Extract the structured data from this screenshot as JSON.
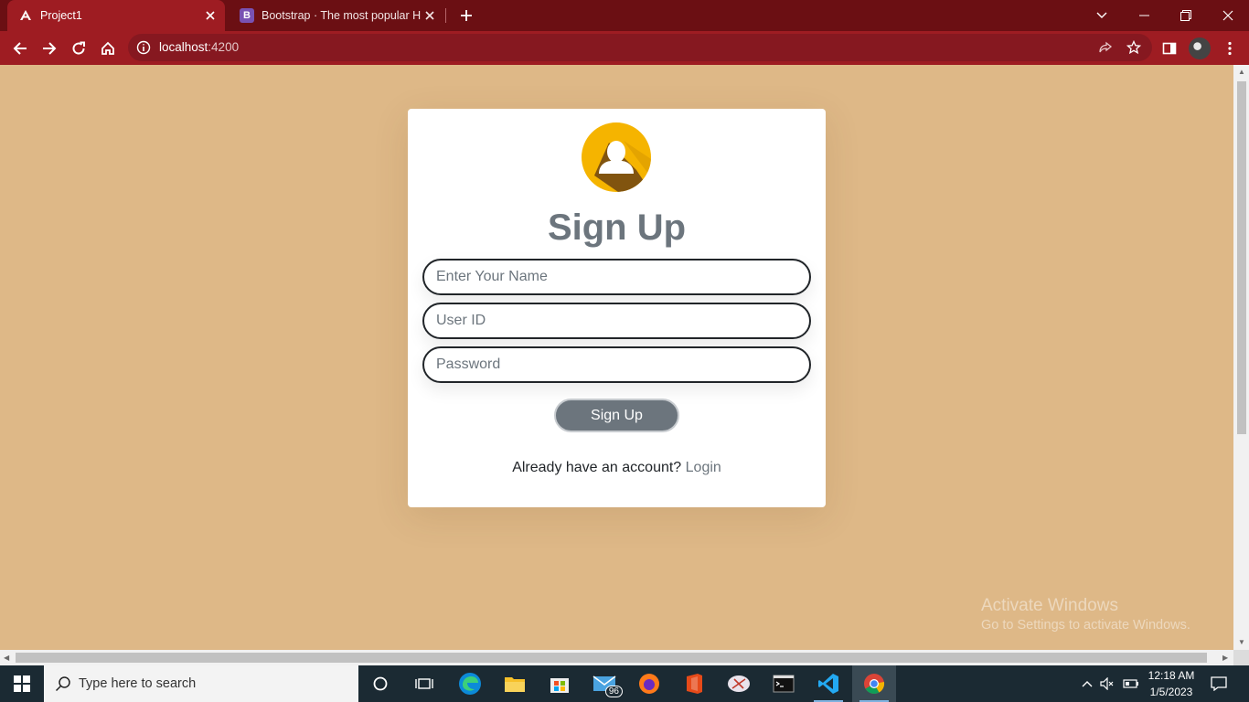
{
  "browser": {
    "tabs": [
      {
        "title": "Project1",
        "favicon": "angular-icon"
      },
      {
        "title": "Bootstrap · The most popular HTML",
        "favicon": "bootstrap-icon"
      }
    ],
    "url_host": "localhost",
    "url_port": ":4200"
  },
  "signup": {
    "heading": "Sign Up",
    "name_placeholder": "Enter Your Name",
    "userid_placeholder": "User ID",
    "password_placeholder": "Password",
    "button_label": "Sign Up",
    "already_text": "Already have an account?",
    "login_link": "Login"
  },
  "watermark": {
    "title": "Activate Windows",
    "subtitle": "Go to Settings to activate Windows."
  },
  "taskbar": {
    "search_placeholder": "Type here to search",
    "mail_badge": "96",
    "time": "12:18 AM",
    "date": "1/5/2023"
  },
  "colors": {
    "page_background": "#deb887",
    "browser_frame": "#9e1c22",
    "secondary_text": "#6c757d",
    "avatar_yellow": "#f5b400"
  }
}
